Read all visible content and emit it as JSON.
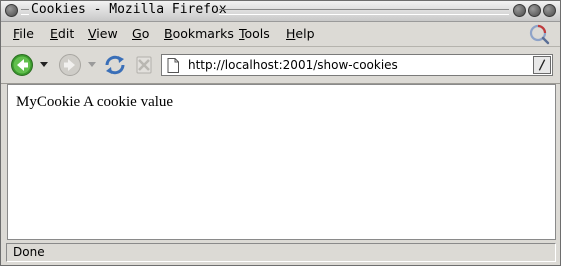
{
  "window": {
    "title": "Cookies - Mozilla Firefox"
  },
  "menu": {
    "items": [
      {
        "acc": "F",
        "rest": "ile"
      },
      {
        "acc": "E",
        "rest": "dit"
      },
      {
        "acc": "V",
        "rest": "iew"
      },
      {
        "acc": "G",
        "rest": "o"
      },
      {
        "acc": "B",
        "rest": "ookmarks"
      },
      {
        "acc": "T",
        "rest": "ools"
      },
      {
        "acc": "H",
        "rest": "elp"
      }
    ]
  },
  "navigation": {
    "url": "http://localhost:2001/show-cookies",
    "icons": [
      "back-icon",
      "forward-icon",
      "reload-icon",
      "stop-icon",
      "page-icon",
      "go-icon",
      "throbber-icon"
    ]
  },
  "page": {
    "content": "MyCookie A cookie value"
  },
  "status": {
    "text": "Done"
  },
  "colors": {
    "chrome": "#dcdad5",
    "back_arrow": "#3c9a2e",
    "reload_blue": "#3a6fb8"
  }
}
